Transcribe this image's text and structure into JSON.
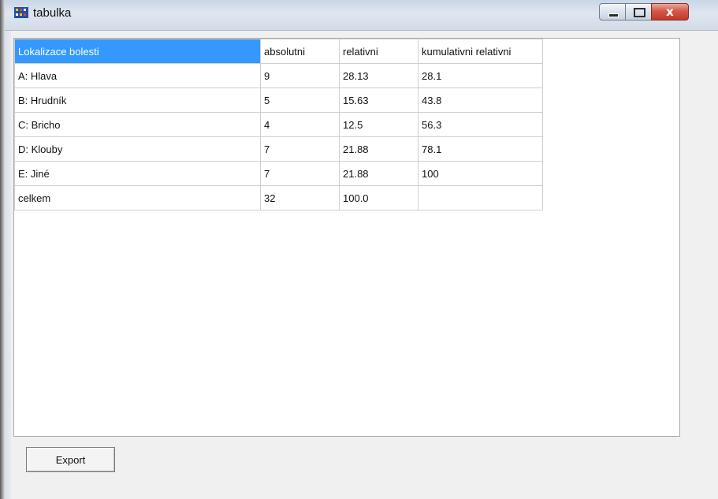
{
  "window": {
    "title": "tabulka",
    "close_glyph": "x"
  },
  "table": {
    "headers": [
      "Lokalizace bolesti",
      "absolutni",
      "relativni",
      "kumulativni relativni"
    ],
    "rows": [
      [
        "A: Hlava",
        "9",
        "28.13",
        "28.1"
      ],
      [
        "B: Hrudník",
        "5",
        "15.63",
        "43.8"
      ],
      [
        "C: Bricho",
        "4",
        "12.5",
        "56.3"
      ],
      [
        "D: Klouby",
        "7",
        "21.88",
        "78.1"
      ],
      [
        "E: Jiné",
        "7",
        "21.88",
        "100"
      ],
      [
        "celkem",
        "32",
        "100.0",
        ""
      ]
    ]
  },
  "buttons": {
    "export_label": "Export"
  },
  "colors": {
    "selection": "#3399ff",
    "close_button": "#c0392b"
  }
}
